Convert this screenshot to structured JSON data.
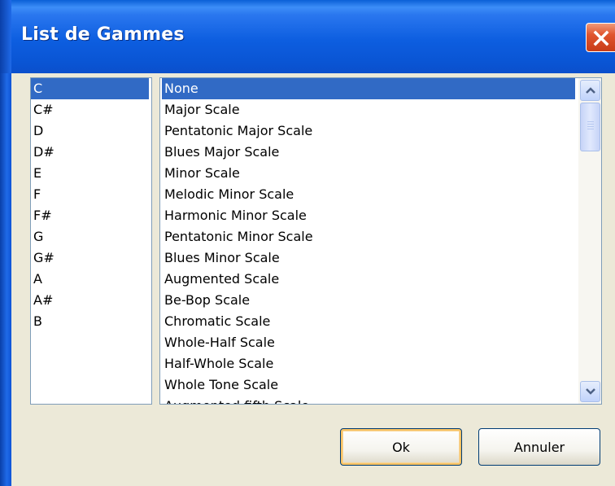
{
  "window": {
    "title": "List de Gammes",
    "close_icon": "close-icon"
  },
  "notes": {
    "selected": "C",
    "items": [
      {
        "label": "C"
      },
      {
        "label": "C#"
      },
      {
        "label": "D"
      },
      {
        "label": "D#"
      },
      {
        "label": "E"
      },
      {
        "label": "F"
      },
      {
        "label": "F#"
      },
      {
        "label": "G"
      },
      {
        "label": "G#"
      },
      {
        "label": "A"
      },
      {
        "label": "A#"
      },
      {
        "label": "B"
      }
    ]
  },
  "scales": {
    "selected": "None",
    "items": [
      {
        "label": "None"
      },
      {
        "label": "Major Scale"
      },
      {
        "label": "Pentatonic Major Scale"
      },
      {
        "label": "Blues Major Scale"
      },
      {
        "label": "Minor Scale"
      },
      {
        "label": "Melodic Minor Scale"
      },
      {
        "label": "Harmonic Minor Scale"
      },
      {
        "label": "Pentatonic Minor Scale"
      },
      {
        "label": "Blues Minor Scale"
      },
      {
        "label": "Augmented Scale"
      },
      {
        "label": "Be-Bop Scale"
      },
      {
        "label": "Chromatic Scale"
      },
      {
        "label": "Whole-Half Scale"
      },
      {
        "label": "Half-Whole Scale"
      },
      {
        "label": "Whole Tone Scale"
      },
      {
        "label": "Augmented fifth Scale"
      }
    ],
    "scroll_icons": [
      "chevron-up-icon",
      "chevron-down-icon"
    ]
  },
  "buttons": {
    "ok_label": "Ok",
    "cancel_label": "Annuler"
  },
  "colors": {
    "titlebar": "#0a55d4",
    "selection": "#316ac5",
    "dialog_bg": "#ece9d8",
    "close_button": "#e0552e"
  }
}
